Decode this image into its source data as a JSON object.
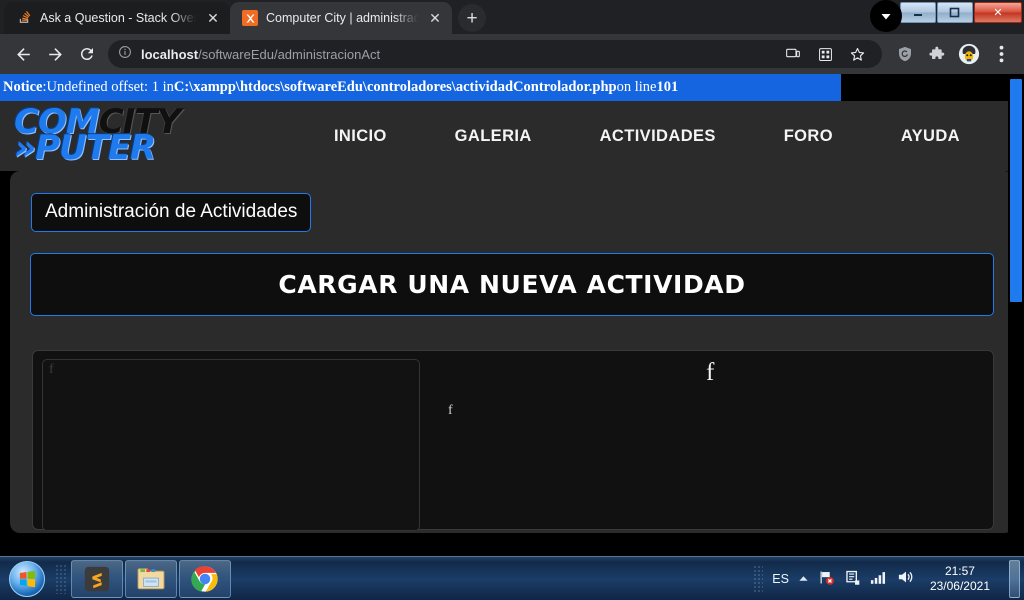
{
  "browser": {
    "tabs": [
      {
        "title": "Ask a Question - Stack Overflow",
        "favicon": "stackoverflow-icon",
        "active": false,
        "close_label": "✕"
      },
      {
        "title": "Computer City | administracionAc",
        "favicon": "xampp-icon",
        "active": true,
        "close_label": "✕"
      }
    ],
    "new_tab_label": "+",
    "nav": {
      "back_icon": "back-arrow-icon",
      "forward_icon": "forward-arrow-icon",
      "reload_icon": "reload-icon"
    },
    "omnibox": {
      "info_icon": "site-info-icon",
      "url_host": "localhost",
      "url_path": "/softwareEdu/administracionAct"
    },
    "toolbar_icons": [
      "cast-icon",
      "qr-code-icon",
      "bookmark-star-icon",
      "shield-icon",
      "extensions-puzzle-icon",
      "profile-avatar-icon",
      "three-dot-menu-icon"
    ],
    "window_controls": {
      "download_indicator": "download-arrow-icon",
      "minimize": "–",
      "maximize": "❐",
      "close": "✕"
    }
  },
  "page": {
    "notice": {
      "label": "Notice",
      "separator": ": ",
      "message": "Undefined offset: 1 in ",
      "file": "C:\\xampp\\htdocs\\softwareEdu\\controladores\\actividadControlador.php",
      "line_prefix": " on line ",
      "line_number": "101",
      "background_color": "#1565e0"
    },
    "logo": {
      "line1_part1": "COM",
      "line1_part2": "CITY",
      "line2_prefix": "»",
      "line2_text": "PUTER",
      "blue": "#1f7aed"
    },
    "nav_items": [
      {
        "label": "INICIO"
      },
      {
        "label": "GALERIA"
      },
      {
        "label": "ACTIVIDADES"
      },
      {
        "label": "FORO"
      },
      {
        "label": "AYUDA"
      }
    ],
    "title_box": "Administración de Actividades",
    "banner": "CARGAR UNA NUEVA ACTIVIDAD",
    "form_markers": {
      "inner_box_char": "f",
      "middle_char": "f",
      "top_char": "f"
    },
    "accent_color": "#1f7aed",
    "scrollbar": {
      "thumb_color": "#1f7aed"
    }
  },
  "taskbar": {
    "start_label": "start-orb",
    "apps": [
      {
        "name": "sublime-text-icon",
        "glyph": "S"
      },
      {
        "name": "file-explorer-icon",
        "glyph": ""
      },
      {
        "name": "google-chrome-icon",
        "glyph": ""
      }
    ],
    "tray": {
      "language": "ES",
      "show_hidden_icon": "chevron-up-icon",
      "network_icon": "network-error-icon",
      "action_center_icon": "action-center-icon",
      "signal_icon": "signal-bars-icon",
      "volume_icon": "volume-icon",
      "time": "21:57",
      "date": "23/06/2021"
    }
  }
}
